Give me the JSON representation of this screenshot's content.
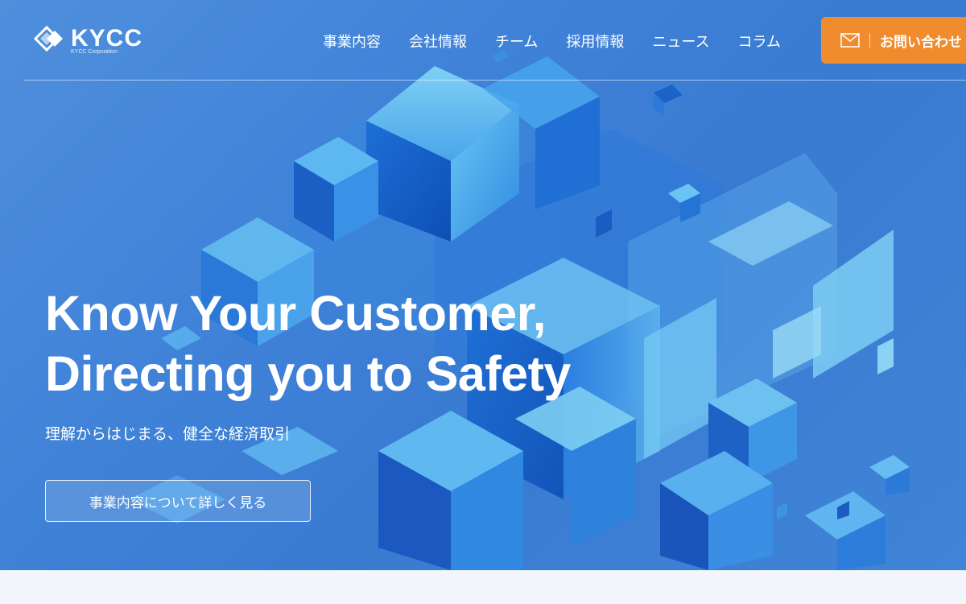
{
  "brand": {
    "name": "KYCC",
    "subtitle": "KYCC Corporation",
    "accent": "#f08c2e",
    "hero_color": "#3f82d8"
  },
  "nav": {
    "items": [
      {
        "label": "事業内容"
      },
      {
        "label": "会社情報"
      },
      {
        "label": "チーム"
      },
      {
        "label": "採用情報"
      },
      {
        "label": "ニュース"
      },
      {
        "label": "コラム"
      }
    ]
  },
  "contact": {
    "label": "お問い合わせ",
    "icon": "mail-icon"
  },
  "hero": {
    "headline_line1": "Know Your Customer,",
    "headline_line2": "Directing you to Safety",
    "subline": "理解からはじまる、健全な経済取引",
    "cta_label": "事業内容について詳しく見る"
  }
}
